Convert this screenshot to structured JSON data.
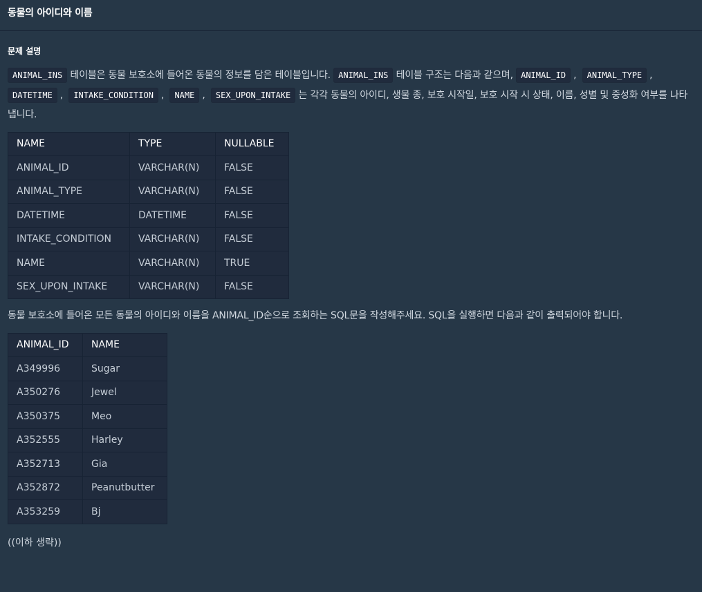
{
  "header": {
    "title": "동물의 아이디와 이름"
  },
  "section": {
    "title": "문제 설명"
  },
  "intro": {
    "code_animal_ins": "ANIMAL_INS",
    "text1": "테이블은 동물 보호소에 들어온 동물의 정보를 담은 테이블입니다.",
    "code_animal_ins2": "ANIMAL_INS",
    "text2": "테이블 구조는 다음과 같으며,",
    "code_animal_id": "ANIMAL_ID",
    "code_animal_type": "ANIMAL_TYPE",
    "code_datetime": "DATETIME",
    "code_intake_condition": "INTAKE_CONDITION",
    "code_name": "NAME",
    "code_sex_upon_intake": "SEX_UPON_INTAKE",
    "sep": ",",
    "text3": "는 각각 동물의 아이디, 생물 종, 보호 시작일, 보호 시작 시 상태, 이름, 성별 및 중성화 여부를 나타냅니다."
  },
  "schema_table": {
    "headers": [
      "NAME",
      "TYPE",
      "NULLABLE"
    ],
    "rows": [
      [
        "ANIMAL_ID",
        "VARCHAR(N)",
        "FALSE"
      ],
      [
        "ANIMAL_TYPE",
        "VARCHAR(N)",
        "FALSE"
      ],
      [
        "DATETIME",
        "DATETIME",
        "FALSE"
      ],
      [
        "INTAKE_CONDITION",
        "VARCHAR(N)",
        "FALSE"
      ],
      [
        "NAME",
        "VARCHAR(N)",
        "TRUE"
      ],
      [
        "SEX_UPON_INTAKE",
        "VARCHAR(N)",
        "FALSE"
      ]
    ]
  },
  "task": {
    "text": "동물 보호소에 들어온 모든 동물의 아이디와 이름을 ANIMAL_ID순으로 조회하는 SQL문을 작성해주세요. SQL을 실행하면 다음과 같이 출력되어야 합니다."
  },
  "result_table": {
    "headers": [
      "ANIMAL_ID",
      "NAME"
    ],
    "rows": [
      [
        "A349996",
        "Sugar"
      ],
      [
        "A350276",
        "Jewel"
      ],
      [
        "A350375",
        "Meo"
      ],
      [
        "A352555",
        "Harley"
      ],
      [
        "A352713",
        "Gia"
      ],
      [
        "A352872",
        "Peanutbutter"
      ],
      [
        "A353259",
        "Bj"
      ]
    ]
  },
  "footnote": "((이하 생략))",
  "colors": {
    "background": "#263747",
    "table_background": "#202b3d",
    "border": "#172334",
    "text": "#d1d8e0"
  }
}
